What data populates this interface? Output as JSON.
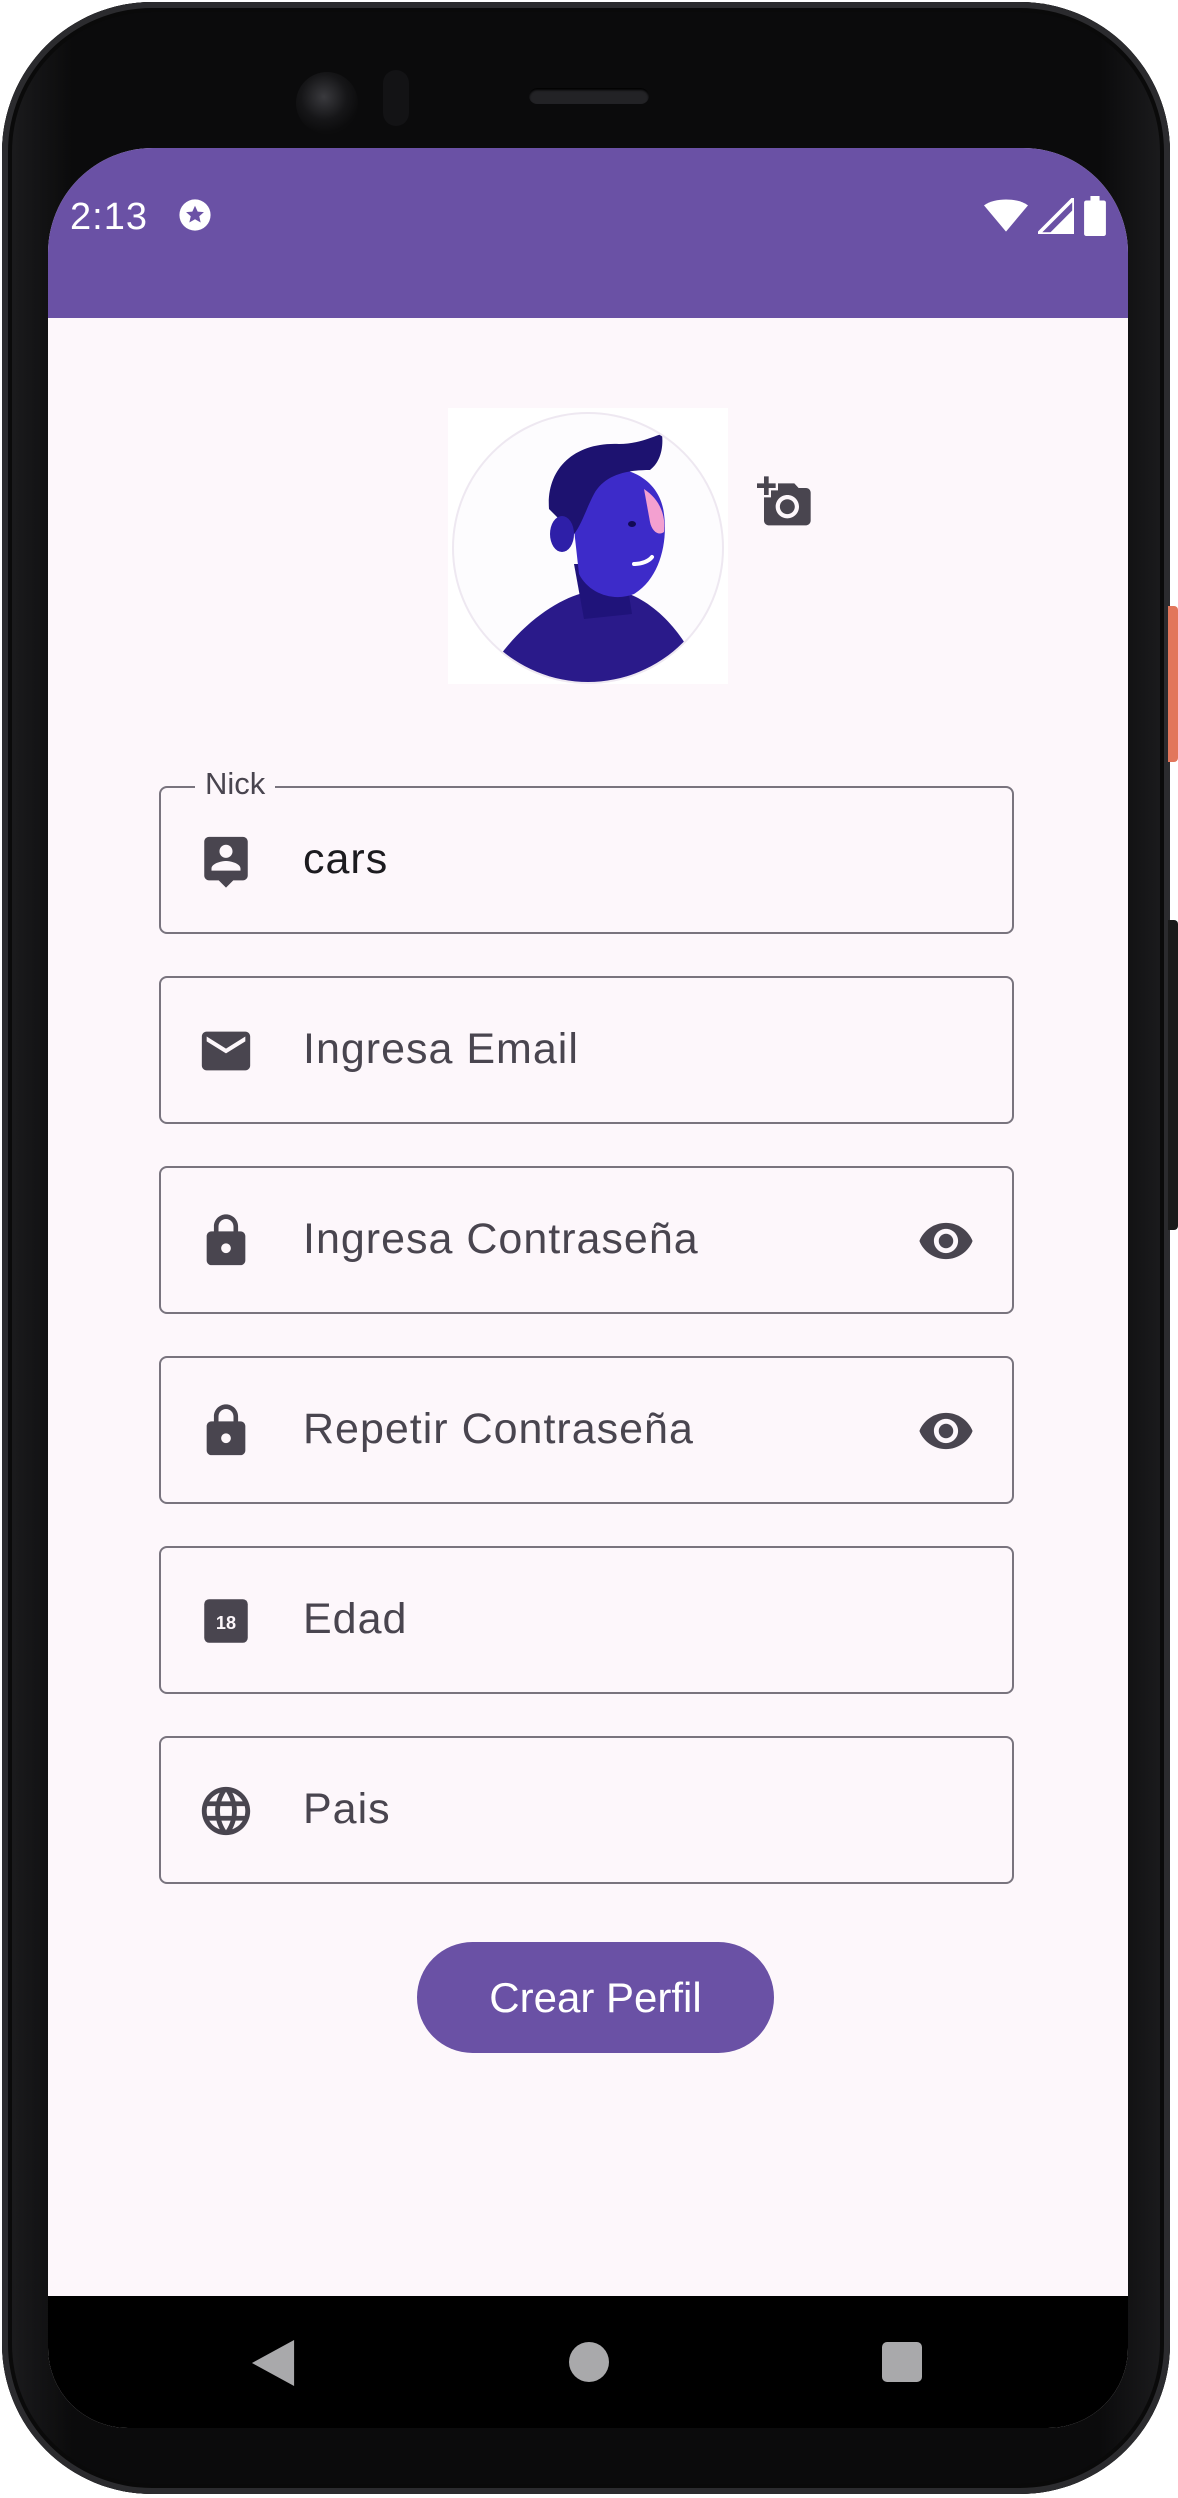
{
  "status_bar": {
    "time": "2:13",
    "icons": [
      "star-circle-icon",
      "wifi-icon",
      "signal-icon",
      "battery-icon"
    ]
  },
  "profile": {
    "avatar_icon": "avatar-illustration",
    "add_photo_icon": "add-a-photo-icon"
  },
  "form": {
    "nick": {
      "label": "Nick",
      "value": "cars",
      "icon": "account-box-icon"
    },
    "email": {
      "placeholder": "Ingresa Email",
      "icon": "email-icon"
    },
    "password": {
      "placeholder": "Ingresa Contraseña",
      "icon": "lock-icon",
      "toggle_icon": "eye-icon"
    },
    "repeat_password": {
      "placeholder": "Repetir Contraseña",
      "icon": "lock-icon",
      "toggle_icon": "eye-icon"
    },
    "age": {
      "placeholder": "Edad",
      "icon": "calendar-18-icon"
    },
    "country": {
      "placeholder": "Pais",
      "icon": "globe-icon"
    }
  },
  "actions": {
    "create_label": "Crear Perfil"
  },
  "nav_bar": {
    "icons": [
      "back-icon",
      "home-icon",
      "recents-icon"
    ]
  },
  "colors": {
    "primary": "#6a51a5",
    "background": "#fdf7fb",
    "outline": "#79747e",
    "text": "#49454f"
  }
}
